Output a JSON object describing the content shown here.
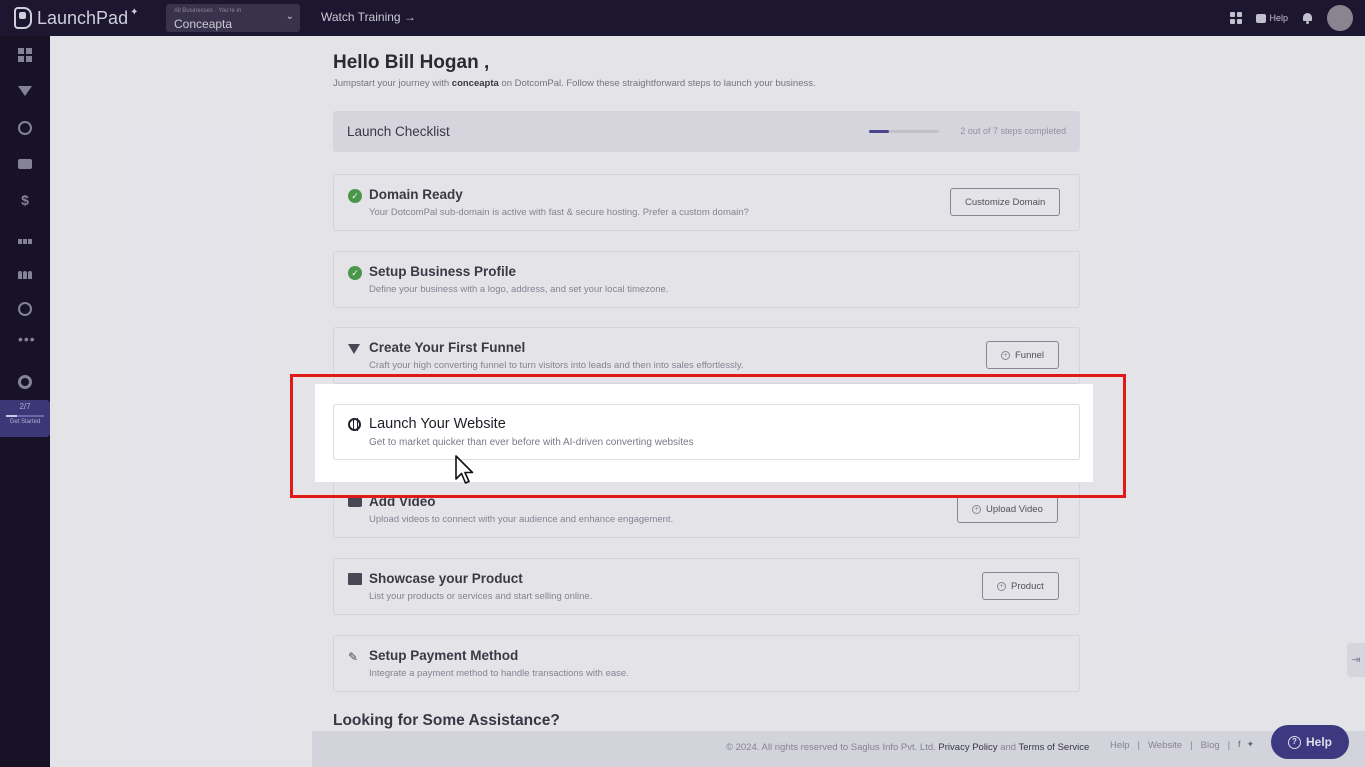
{
  "app": {
    "logo_text": "LaunchPad",
    "business_caption": "All Businesses · You're in",
    "business_name": "Conceapta",
    "watch_training": "Watch Training →",
    "help_label": "Help"
  },
  "sidebar": {
    "progress_fraction": "2/7",
    "progress_label": "Get Started",
    "progress_value": 0.2857
  },
  "main": {
    "greeting": "Hello Bill Hogan ,",
    "subtitle_pre": "Jumpstart your journey with ",
    "subtitle_brand": "conceapta",
    "subtitle_post": " on DotcomPal. Follow these straightforward steps to launch your business.",
    "checklist_title": "Launch Checklist",
    "checklist_progress": "2 out of 7 steps completed",
    "checklist_progress_value": 0.2857,
    "steps": [
      {
        "title": "Domain Ready",
        "desc": "Your DotcomPal sub-domain is active with fast & secure hosting. Prefer a custom domain?",
        "button": "Customize Domain",
        "done": true
      },
      {
        "title": "Setup Business Profile",
        "desc": "Define your business with a logo, address, and set your local timezone.",
        "button": "",
        "done": true
      },
      {
        "title": "Create Your First Funnel",
        "desc": "Craft your high converting funnel to turn visitors into leads and then into sales effortlessly.",
        "button": "Funnel",
        "done": false
      },
      {
        "title": "Launch Your Website",
        "desc": "Get to market quicker than ever before with AI-driven converting websites",
        "button": "",
        "done": false
      },
      {
        "title": "Add Video",
        "desc": "Upload videos to connect with your audience and enhance engagement.",
        "button": "Upload Video",
        "done": false
      },
      {
        "title": "Showcase your Product",
        "desc": "List your products or services and start selling online.",
        "button": "Product",
        "done": false
      },
      {
        "title": "Setup Payment Method",
        "desc": "Integrate a payment method to handle transactions with ease.",
        "button": "",
        "done": false
      }
    ],
    "assistance_title": "Looking for Some Assistance?"
  },
  "footer": {
    "copyright": "©  2024. All rights reserved to Saglus Info Pvt. Ltd.",
    "privacy": "Privacy Policy",
    "and": "and",
    "terms": "Terms of Service",
    "link_help": "Help",
    "link_website": "Website",
    "link_blog": "Blog",
    "sep": "|",
    "facebook": "f",
    "twitter": "🐦"
  },
  "help_button": "Help",
  "colors": {
    "topbar": "#1d1631",
    "accent": "#3f3b86",
    "highlight": "#e01919",
    "done": "#4c9c4c"
  }
}
